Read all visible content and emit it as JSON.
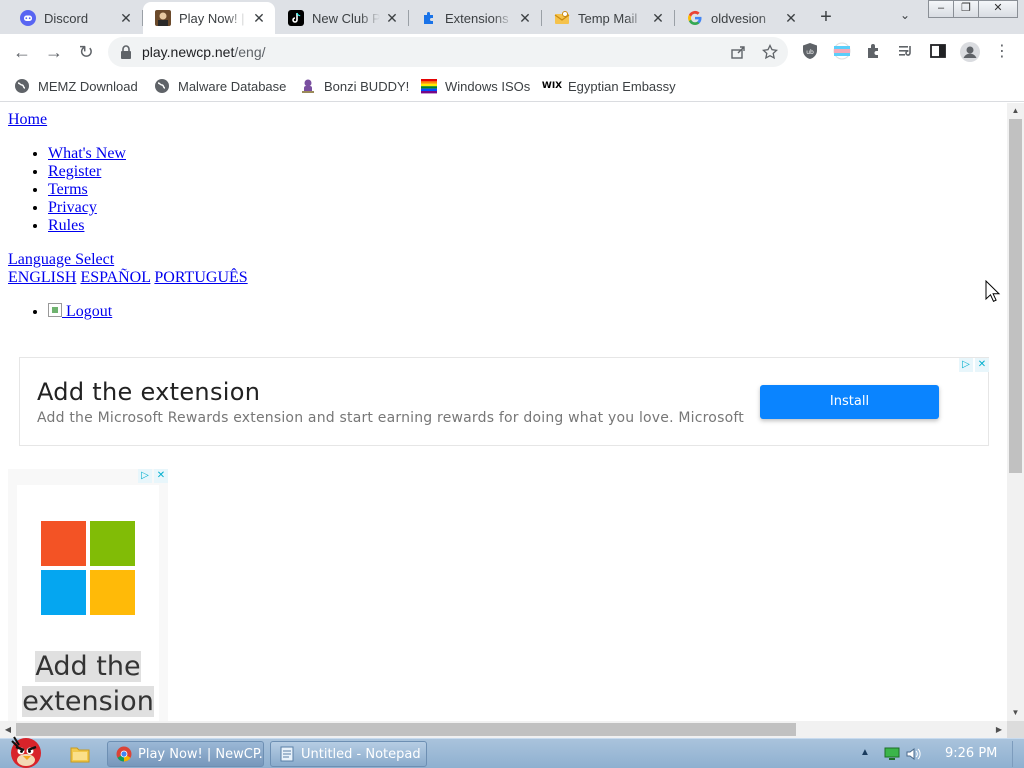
{
  "browser": {
    "tabs": [
      {
        "title": "Discord",
        "active": false,
        "favicon": "discord-icon"
      },
      {
        "title": "Play Now! | NewCP",
        "active": true,
        "favicon": "newcp-icon"
      },
      {
        "title": "New Club Penguin",
        "active": false,
        "favicon": "tiktok-icon"
      },
      {
        "title": "Extensions",
        "active": false,
        "favicon": "puzzle-icon"
      },
      {
        "title": "Temp Mail",
        "active": false,
        "favicon": "mail-icon"
      },
      {
        "title": "oldvesion",
        "active": false,
        "favicon": "google-icon"
      }
    ],
    "url_host": "play.newcp.net",
    "url_path": "/eng/",
    "bookmarks": [
      {
        "label": "MEMZ Download",
        "icon": "globe-icon"
      },
      {
        "label": "Malware Database",
        "icon": "globe-icon"
      },
      {
        "label": "Bonzi BUDDY!",
        "icon": "bonzi-icon"
      },
      {
        "label": "Windows ISOs",
        "icon": "rainbow-flag-icon"
      },
      {
        "label": "Egyptian Embassy",
        "icon": "wix-icon"
      }
    ],
    "bookmark_wix_text": "WIX"
  },
  "page": {
    "home": "Home",
    "nav": [
      "What's New",
      "Register",
      "Terms",
      "Privacy",
      "Rules"
    ],
    "language_select": "Language Select",
    "languages": [
      "ENGLISH",
      "ESPAÑOL",
      "PORTUGUÊS"
    ],
    "logout": " Logout"
  },
  "ads": {
    "banner_heading": "Add the extension",
    "banner_desc": "Add the Microsoft Rewards extension and start earning rewards for doing what you love. Microsoft",
    "banner_button": "Install",
    "tall_heading_line1": "Add the",
    "tall_heading_line2": "extension",
    "ms_colors": [
      "#f35325",
      "#81bc06",
      "#05a6f0",
      "#ffba08"
    ]
  },
  "taskbar": {
    "buttons": [
      {
        "label": "Play Now! | NewCP...",
        "icon": "chrome-icon"
      },
      {
        "label": "Untitled - Notepad",
        "icon": "notepad-icon"
      }
    ],
    "clock": "9:26 PM"
  },
  "colors": {
    "link": "#0000ee",
    "install_button": "#0a84ff",
    "tabstrip": "#dee1e6"
  }
}
